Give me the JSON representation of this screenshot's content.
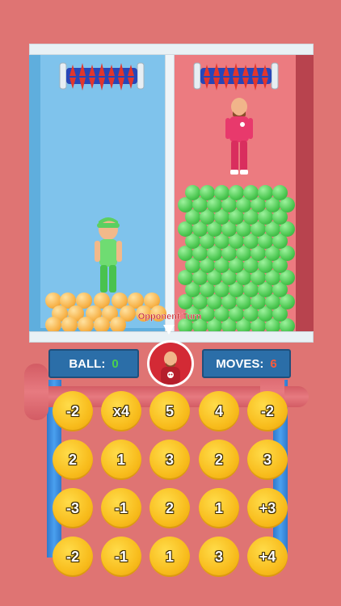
{
  "game": {
    "opponent_turn_label": "Opponent Turn"
  },
  "score_bar": {
    "ball_label": "BALL:",
    "ball_value": "0",
    "moves_label": "MOVES:",
    "moves_value": "6"
  },
  "coins": [
    [
      "-2",
      "x4",
      "5",
      "4",
      "-2"
    ],
    [
      "2",
      "1",
      "3",
      "2",
      "3"
    ],
    [
      "-3",
      "-1",
      "2",
      "1",
      "+3"
    ],
    [
      "-2",
      "-1",
      "1",
      "3",
      "+4"
    ]
  ],
  "colors": {
    "background": "#df7473",
    "player_room": "#7fc3ec",
    "opponent_room": "#ec7b80",
    "ball_orange": "#f7b34a",
    "ball_green": "#4cc851",
    "coin": "#f8bc1c",
    "stat_panel": "#2b6ea8"
  }
}
